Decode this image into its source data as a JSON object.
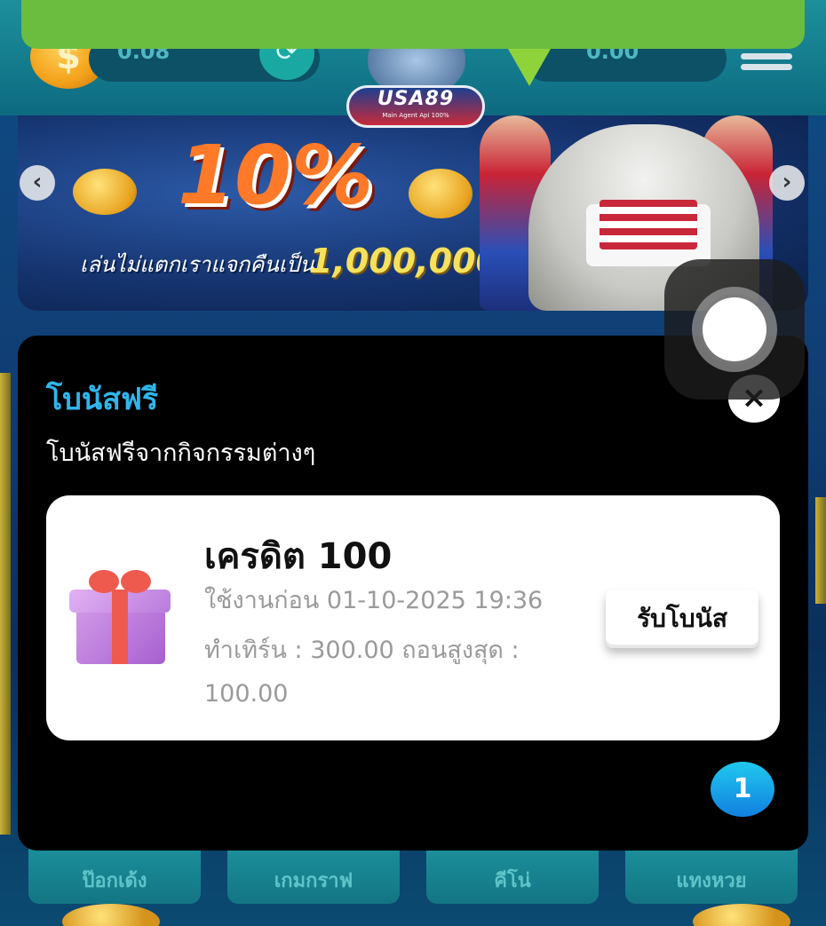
{
  "header": {
    "wallet_left_value": "0.08",
    "wallet_right_value": "0.00",
    "logo_text": "USA89",
    "logo_subtext": "Main Agent Api 100%"
  },
  "banner": {
    "percent": "10%",
    "caption": "เล่นไม่แตกเราแจกคืนเป็น",
    "amount": "1,000,000",
    "prev_icon": "chevron-left-icon",
    "next_icon": "chevron-right-icon"
  },
  "modal": {
    "title": "โบนัสฟรี",
    "subtitle": "โบนัสฟรีจากกิจกรรมต่างๆ",
    "close_glyph": "×",
    "card": {
      "title": "เครดิต 100",
      "expires": "ใช้งานก่อน 01-10-2025 19:36",
      "turnover": "ทำเทิร์น : 300.00  ถอนสูงสุด :",
      "max_withdraw": "100.00",
      "claim_label": "รับโบนัส"
    },
    "page_number": "1"
  },
  "games": [
    {
      "label": "ป๊อกเด้ง"
    },
    {
      "label": "เกมกราฟ"
    },
    {
      "label": "คีโน่"
    },
    {
      "label": "แทงหวย"
    }
  ],
  "colors": {
    "toast": "#6bbd3f",
    "header": "#137a8c",
    "modal_title": "#2fb6ec",
    "page_badge": "#1280e0"
  }
}
